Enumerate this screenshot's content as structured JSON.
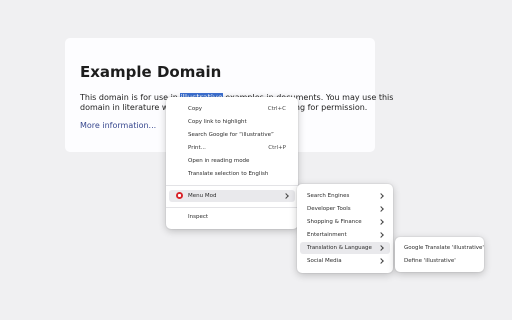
{
  "page": {
    "title": "Example Domain",
    "line1_before": "This domain is for use in ",
    "line1_selected": "illustrative",
    "line1_after": " examples in documents. You may use this",
    "line2": "domain in literature without prior coordination or asking for permission.",
    "more_link": "More information..."
  },
  "context_menu": {
    "items": [
      {
        "label": "Copy",
        "shortcut": "Ctrl+C"
      },
      {
        "label": "Copy link to highlight"
      },
      {
        "label": "Search Google for “illustrative”"
      },
      {
        "label": "Print...",
        "shortcut": "Ctrl+P"
      },
      {
        "label": "Open in reading mode"
      },
      {
        "label": "Translate selection to English"
      },
      {
        "label": "Menu Mod",
        "icon": "menu-mod-icon",
        "has_submenu": true
      },
      {
        "label": "Inspect"
      }
    ]
  },
  "submenu": {
    "items": [
      {
        "label": "Search Engines"
      },
      {
        "label": "Developer Tools"
      },
      {
        "label": "Shopping & Finance"
      },
      {
        "label": "Entertainment"
      },
      {
        "label": "Translation & Language"
      },
      {
        "label": "Social Media"
      }
    ]
  },
  "submenu2": {
    "items": [
      {
        "label": "Google Translate 'illustrative'"
      },
      {
        "label": "Define 'illustrative'"
      }
    ]
  },
  "colors": {
    "selection": "#3b6fd0",
    "link": "#38488f",
    "menu_mod_icon": "#d8232a",
    "background": "#f0f0f2"
  }
}
